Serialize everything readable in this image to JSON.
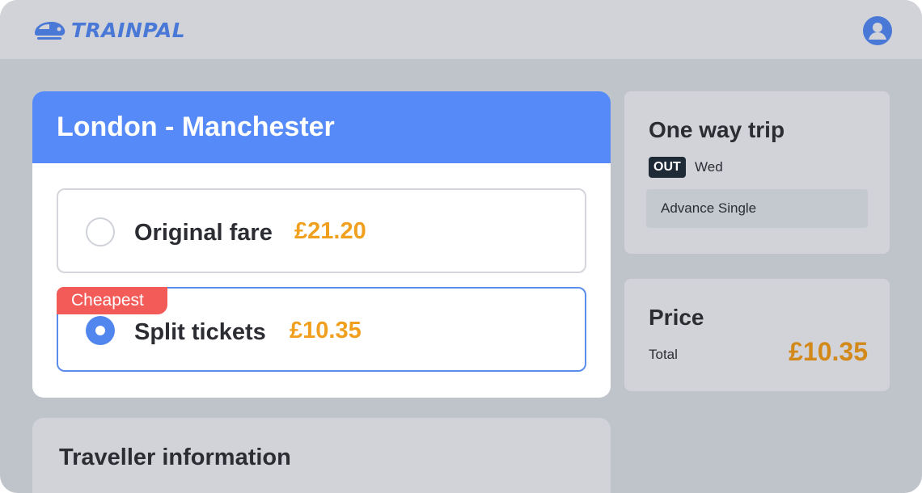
{
  "brand": {
    "name": "TRAINPAL",
    "logo_icon": "train-icon",
    "color": "#4a78d6"
  },
  "header": {
    "account_icon": "user-icon"
  },
  "route": {
    "title": "London - Manchester"
  },
  "fares": [
    {
      "label": "Original fare",
      "price": "£21.20",
      "selected": false
    },
    {
      "label": "Split tickets",
      "price": "£10.35",
      "selected": true,
      "badge": "Cheapest"
    }
  ],
  "traveller": {
    "title": "Traveller information"
  },
  "trip": {
    "title": "One way trip",
    "direction": "OUT",
    "day": "Wed",
    "ticket_type": "Advance Single"
  },
  "price": {
    "title": "Price",
    "total_label": "Total",
    "total_value": "£10.35"
  },
  "colors": {
    "accent": "#558af8",
    "price": "#f0a01e",
    "badge": "#f25b58"
  }
}
